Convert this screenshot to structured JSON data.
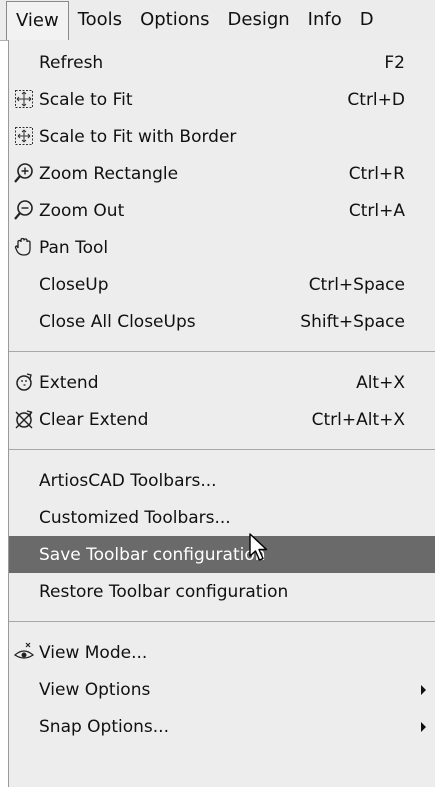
{
  "menubar": {
    "items": [
      "View",
      "Tools",
      "Options",
      "Design",
      "Info",
      "D"
    ]
  },
  "menu": {
    "refresh": {
      "label": "Refresh",
      "shortcut": "F2"
    },
    "scale_fit": {
      "label": "Scale to Fit",
      "shortcut": "Ctrl+D"
    },
    "scale_border": {
      "label": "Scale to Fit with Border"
    },
    "zoom_rect": {
      "label": "Zoom Rectangle",
      "shortcut": "Ctrl+R"
    },
    "zoom_out": {
      "label": "Zoom Out",
      "shortcut": "Ctrl+A"
    },
    "pan": {
      "label": "Pan Tool"
    },
    "closeup": {
      "label": "CloseUp",
      "shortcut": "Ctrl+Space"
    },
    "close_all": {
      "label": "Close All CloseUps",
      "shortcut": "Shift+Space"
    },
    "extend": {
      "label": "Extend",
      "shortcut": "Alt+X"
    },
    "clear_extend": {
      "label": "Clear Extend",
      "shortcut": "Ctrl+Alt+X"
    },
    "artios_toolbars": {
      "label": "ArtiosCAD Toolbars..."
    },
    "custom_toolbars": {
      "label": "Customized Toolbars..."
    },
    "save_toolbar": {
      "label": "Save Toolbar configuration"
    },
    "restore_toolbar": {
      "label": "Restore Toolbar configuration"
    },
    "view_mode": {
      "label": "View Mode..."
    },
    "view_options": {
      "label": "View Options"
    },
    "snap_options": {
      "label": "Snap Options..."
    }
  },
  "colors": {
    "menu_bg": "#ededed",
    "highlight": "#6a6a6a"
  }
}
